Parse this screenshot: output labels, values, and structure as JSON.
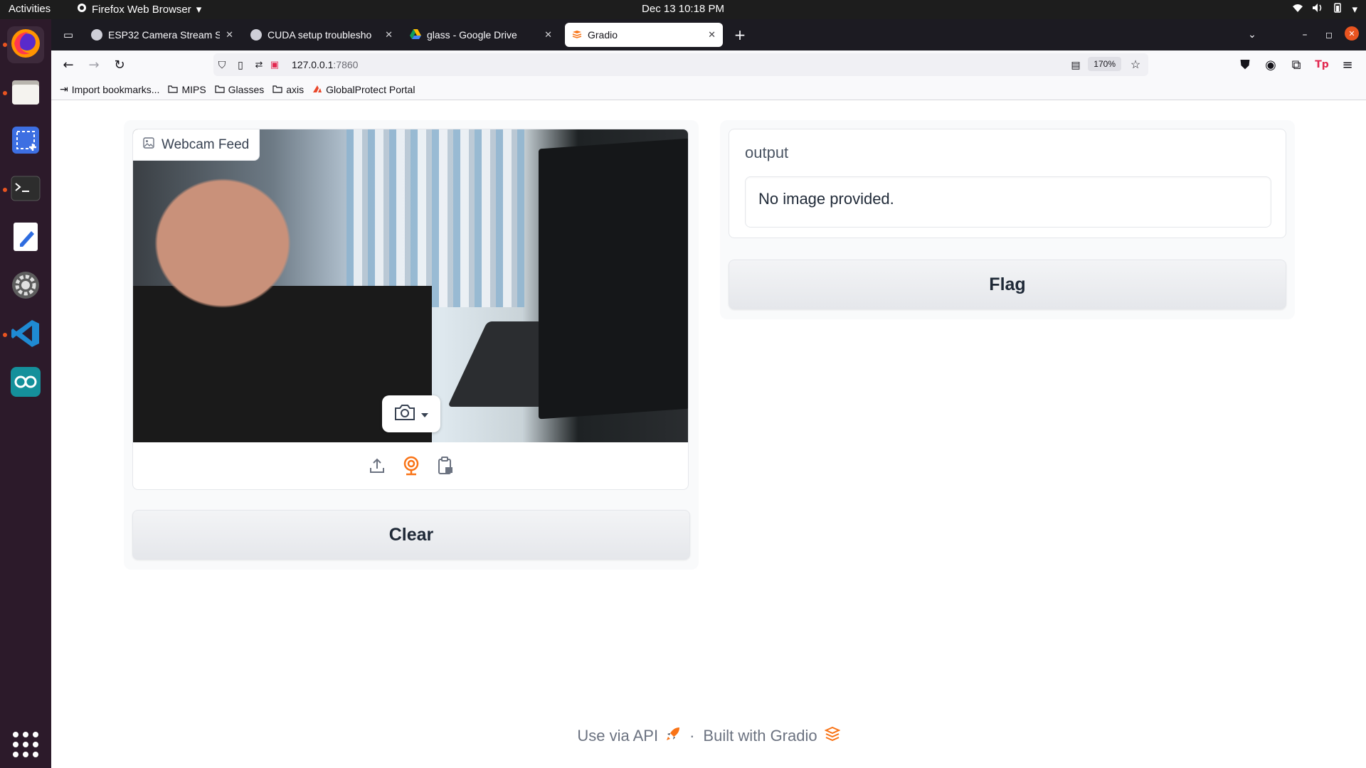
{
  "topbar": {
    "activities": "Activities",
    "app_menu": "Firefox Web Browser",
    "clock": "Dec 13  10:18 PM"
  },
  "dock": {
    "items": [
      "firefox-icon",
      "files-icon",
      "screenshot-icon",
      "terminal-icon",
      "text-editor-icon",
      "settings-icon",
      "vscode-icon",
      "arduino-icon"
    ],
    "accent": "#e95420"
  },
  "tabs": [
    {
      "title": "ESP32 Camera Stream S",
      "active": false
    },
    {
      "title": "CUDA setup troublesho",
      "active": false
    },
    {
      "title": "glass - Google Drive",
      "active": false
    },
    {
      "title": "Gradio",
      "active": true
    }
  ],
  "url": {
    "host": "127.0.0.1",
    "port": ":7860",
    "zoom": "170%"
  },
  "bookmarks": [
    {
      "label": "Import bookmarks...",
      "icon": "import-icon"
    },
    {
      "label": "MIPS",
      "icon": "folder-icon"
    },
    {
      "label": "Glasses",
      "icon": "folder-icon"
    },
    {
      "label": "axis",
      "icon": "folder-icon"
    },
    {
      "label": "GlobalProtect Portal",
      "icon": "globalprotect-icon"
    }
  ],
  "input_panel": {
    "label": "Webcam Feed",
    "clear_label": "Clear"
  },
  "output_panel": {
    "label": "output",
    "value": "No image provided.",
    "flag_label": "Flag"
  },
  "footer": {
    "api_label": "Use via API",
    "separator": "·",
    "built_label": "Built with Gradio"
  },
  "colors": {
    "gradio_orange": "#f97316",
    "tab_bar": "#1c1b22",
    "dock_bg": "#2c1a2a"
  }
}
